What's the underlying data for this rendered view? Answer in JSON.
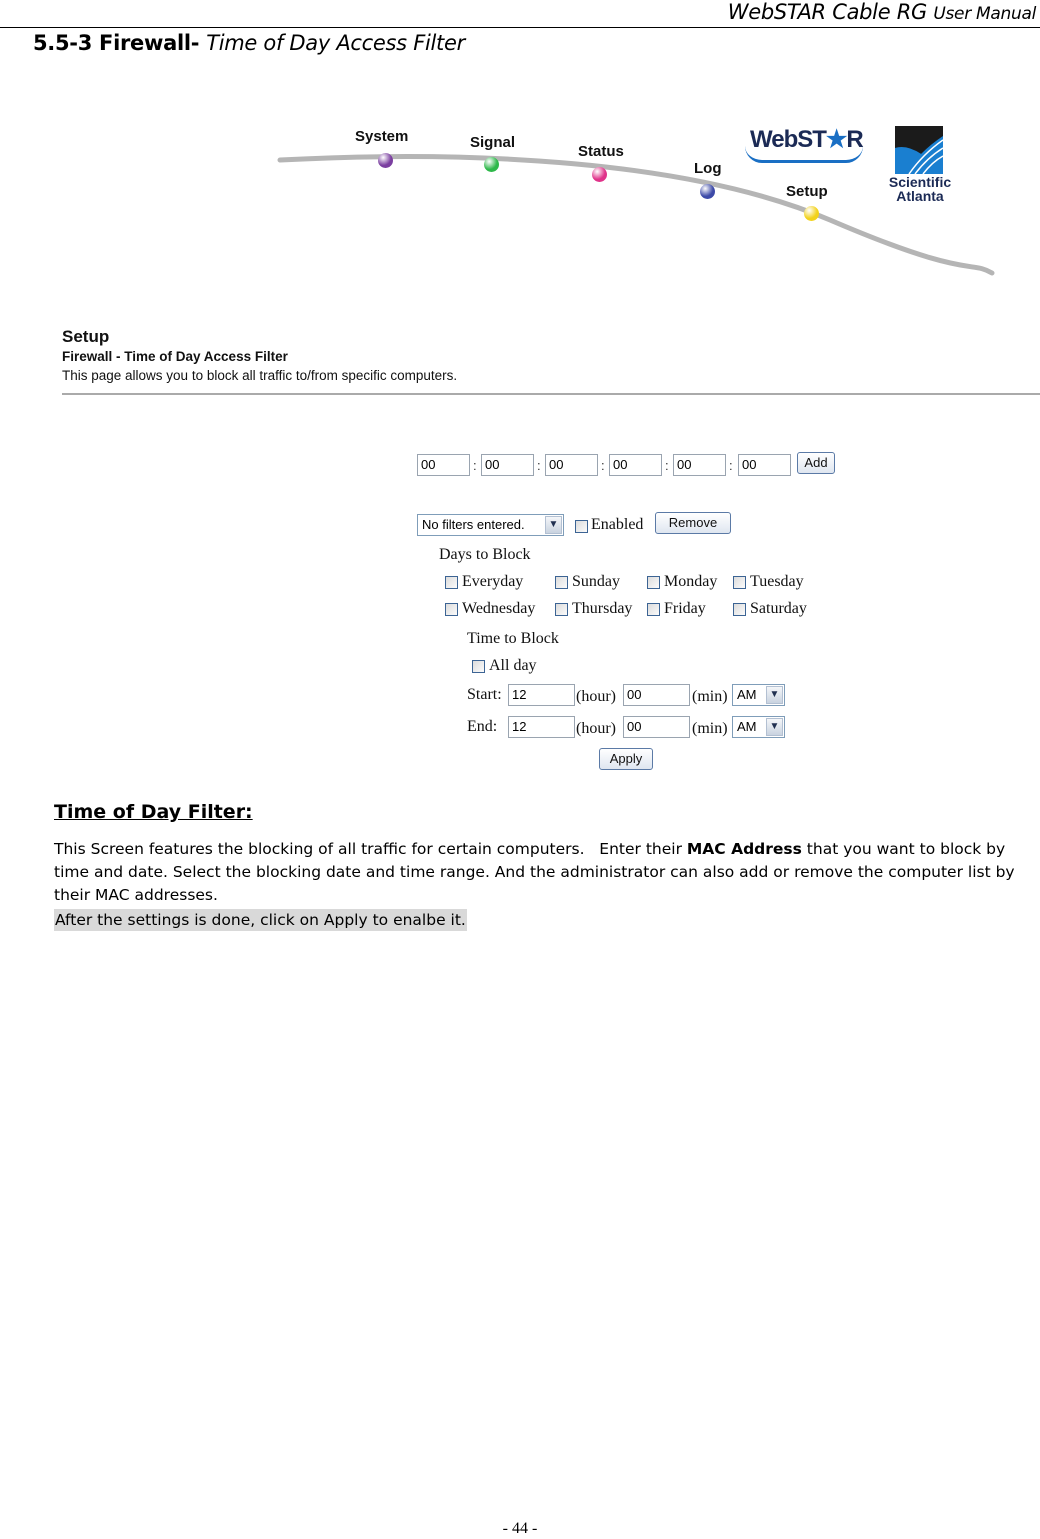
{
  "header": {
    "manual_title_main": "WebSTAR Cable RG",
    "manual_title_suffix": "User Manual"
  },
  "section": {
    "number_and_name": "5.5-3 Firewall-",
    "subtitle": "Time of Day Access Filter"
  },
  "nav": {
    "items": [
      {
        "label": "System",
        "orb_color": "#7b3fa0"
      },
      {
        "label": "Signal",
        "orb_color": "#2eb84a"
      },
      {
        "label": "Status",
        "orb_color": "#e0338a"
      },
      {
        "label": "Log",
        "orb_color": "#3d4aa8"
      },
      {
        "label": "Setup",
        "orb_color": "#f2d21c"
      }
    ],
    "logo_webstar_prefix": "WebST",
    "logo_webstar_star": "★",
    "logo_webstar_suffix": "R",
    "logo_sa_line1": "Scientific",
    "logo_sa_line2": "Atlanta"
  },
  "setup": {
    "heading": "Setup",
    "subheading": "Firewall - Time of Day Access Filter",
    "description": "This page allows you to block all traffic to/from specific computers."
  },
  "form": {
    "mac_fields": [
      "00",
      "00",
      "00",
      "00",
      "00",
      "00"
    ],
    "mac_separator": ":",
    "add_label": "Add",
    "filter_list_selected": "No filters entered.",
    "enabled_label": "Enabled",
    "remove_label": "Remove",
    "days_heading": "Days to Block",
    "days": [
      "Everyday",
      "Sunday",
      "Monday",
      "Tuesday",
      "Wednesday",
      "Thursday",
      "Friday",
      "Saturday"
    ],
    "time_heading": "Time to Block",
    "all_day_label": "All day",
    "start_label": "Start:",
    "end_label": "End:",
    "start_hour": "12",
    "start_min": "00",
    "start_ampm": "AM",
    "end_hour": "12",
    "end_min": "00",
    "end_ampm": "AM",
    "hour_label": "(hour)",
    "min_label": "(min)",
    "apply_label": "Apply"
  },
  "body": {
    "tod_title": "Time of Day Filter:",
    "para_part1": "This Screen features the blocking of all traffic for certain computers.   Enter their ",
    "para_bold": "MAC Address",
    "para_part2": " that you want to block by time and date. Select the blocking date and time range. And the administrator can also add or remove the computer list by their MAC addresses.",
    "note": "After the settings is done, click on Apply to enalbe it."
  },
  "footer": {
    "page_number": "- 44 -"
  }
}
